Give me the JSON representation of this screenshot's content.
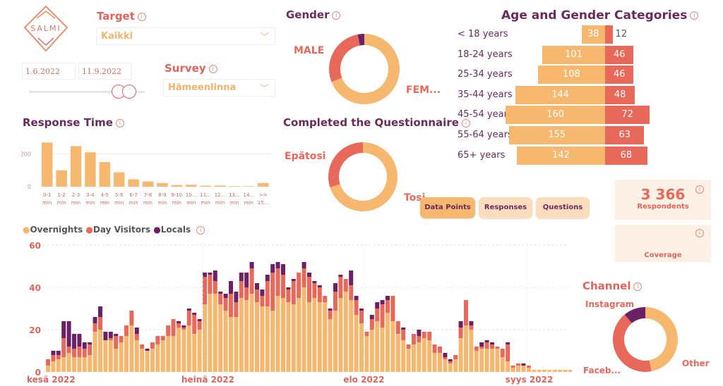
{
  "logo": {
    "text": "SALMI"
  },
  "filters": {
    "target_label": "Target",
    "target_value": "Kaikki",
    "date_start": "1.6.2022",
    "date_end": "11.9.2022",
    "survey_label": "Survey",
    "survey_value": "Hämeenlinna"
  },
  "gender": {
    "title": "Gender",
    "labels": [
      "MALE",
      "FEM..."
    ]
  },
  "completed": {
    "title": "Completed the Questionnaire",
    "labels": [
      "Epätosi",
      "Tosi"
    ]
  },
  "age": {
    "title": "Age and Gender Categories",
    "rows": [
      {
        "label": "< 18 years",
        "female": 38,
        "male": 12
      },
      {
        "label": "18-24 years",
        "female": 101,
        "male": 46
      },
      {
        "label": "25-34 years",
        "female": 108,
        "male": 46
      },
      {
        "label": "35-44 years",
        "female": 144,
        "male": 48
      },
      {
        "label": "45-54 years",
        "female": 160,
        "male": 72
      },
      {
        "label": "55-64 years",
        "female": 155,
        "male": 63
      },
      {
        "label": "65+ years",
        "female": 142,
        "male": 68
      }
    ]
  },
  "buttons": {
    "data_points": "Data Points",
    "responses": "Responses",
    "questions": "Questions"
  },
  "cards": {
    "respondents_value": "3 366",
    "respondents_label": "Respondents",
    "coverage_label": "Coverage"
  },
  "channel": {
    "title": "Channel",
    "labels": [
      "Instagram",
      "Faceb...",
      "Other"
    ]
  },
  "response_time": {
    "title": "Response Time"
  },
  "daily": {
    "legend": [
      "Overnights",
      "Day Visitors",
      "Locals"
    ]
  },
  "colors": {
    "overnights": "#F6B86F",
    "day_visitors": "#E8685A",
    "locals": "#6B2166",
    "title": "#6A2A5E",
    "accent": "#E0645A"
  },
  "chart_data": [
    {
      "type": "pie",
      "title": "Gender",
      "categories": [
        "FEMALE",
        "MALE",
        "Other"
      ],
      "values": [
        69,
        28,
        3
      ]
    },
    {
      "type": "pie",
      "title": "Completed the Questionnaire",
      "categories": [
        "Tosi",
        "Epätosi"
      ],
      "values": [
        70,
        30
      ]
    },
    {
      "type": "pie",
      "title": "Channel",
      "categories": [
        "Other",
        "Facebook",
        "Instagram"
      ],
      "values": [
        47,
        42,
        11
      ]
    },
    {
      "type": "bar",
      "title": "Response Time",
      "categories": [
        "0-1 min",
        "1-2 min",
        "2-3 min",
        "3-4 min",
        "4-5 min",
        "5-6 min",
        "6-7 min",
        "7-8 min",
        "8-9 min",
        "9-10 min",
        "10... min",
        "11... min",
        "12... min",
        "13... min",
        "14... min",
        ">= 15..."
      ],
      "values": [
        270,
        100,
        248,
        210,
        150,
        88,
        45,
        32,
        22,
        10,
        12,
        6,
        7,
        3,
        3,
        22
      ],
      "yticks": [
        0,
        200
      ],
      "ylim": [
        0,
        280
      ]
    },
    {
      "type": "bar",
      "stacked": true,
      "title": "",
      "xticks": [
        "kesä 2022",
        "heinä 2022",
        "elo 2022",
        "syys 2022"
      ],
      "xtick_index": [
        0,
        30,
        61,
        92
      ],
      "yticks": [
        0,
        20,
        40,
        60
      ],
      "ylim": [
        0,
        60
      ],
      "series": [
        {
          "name": "Overnights",
          "values": [
            3,
            5,
            6,
            7,
            9,
            7,
            7,
            7,
            8,
            19,
            20,
            15,
            15,
            11,
            14,
            17,
            22,
            15,
            11,
            10,
            11,
            13,
            15,
            17,
            17,
            21,
            20,
            22,
            18,
            20,
            32,
            37,
            37,
            32,
            29,
            26,
            26,
            35,
            34,
            37,
            33,
            31,
            31,
            29,
            36,
            35,
            33,
            32,
            35,
            40,
            33,
            35,
            33,
            33,
            25,
            29,
            35,
            38,
            34,
            27,
            23,
            17,
            20,
            24,
            21,
            28,
            24,
            18,
            15,
            11,
            13,
            14,
            16,
            15,
            9,
            9,
            6,
            4,
            6,
            16,
            22,
            20,
            10,
            11,
            11,
            11,
            11,
            7,
            5,
            2,
            3,
            3,
            2,
            1,
            1,
            1,
            1,
            1,
            1,
            1,
            1,
            1,
            1
          ]
        },
        {
          "name": "Day Visitors",
          "values": [
            3,
            3,
            2,
            9,
            3,
            4,
            5,
            4,
            5,
            4,
            6,
            0,
            1,
            6,
            3,
            5,
            7,
            3,
            2,
            0,
            3,
            4,
            2,
            5,
            8,
            2,
            1,
            7,
            9,
            4,
            13,
            9,
            6,
            5,
            6,
            11,
            7,
            8,
            6,
            12,
            6,
            5,
            12,
            18,
            13,
            11,
            6,
            11,
            12,
            9,
            12,
            7,
            7,
            3,
            4,
            9,
            10,
            6,
            7,
            7,
            6,
            2,
            5,
            6,
            11,
            6,
            12,
            6,
            5,
            2,
            5,
            3,
            3,
            4,
            4,
            3,
            1,
            1,
            2,
            5,
            12,
            2,
            2,
            1,
            3,
            2,
            1,
            4,
            8,
            1,
            1,
            0,
            1,
            0,
            0,
            0,
            0,
            0,
            0,
            0,
            0,
            0,
            0
          ]
        },
        {
          "name": "Locals",
          "values": [
            0,
            2,
            2,
            8,
            12,
            7,
            6,
            3,
            1,
            3,
            5,
            4,
            3,
            1,
            0,
            0,
            0,
            3,
            0,
            1,
            0,
            0,
            0,
            0,
            0,
            1,
            1,
            1,
            1,
            1,
            2,
            1,
            5,
            1,
            2,
            6,
            5,
            4,
            7,
            3,
            3,
            3,
            3,
            4,
            3,
            5,
            1,
            1,
            0,
            3,
            2,
            1,
            1,
            0,
            1,
            4,
            1,
            0,
            7,
            2,
            1,
            0,
            2,
            3,
            2,
            2,
            0,
            0,
            1,
            0,
            0,
            3,
            0,
            0,
            0,
            0,
            2,
            1,
            0,
            3,
            0,
            2,
            0,
            2,
            1,
            1,
            0,
            0,
            1,
            0,
            0,
            1,
            0,
            0,
            0,
            0,
            0,
            0,
            0,
            0,
            0,
            0,
            0
          ]
        }
      ]
    }
  ]
}
